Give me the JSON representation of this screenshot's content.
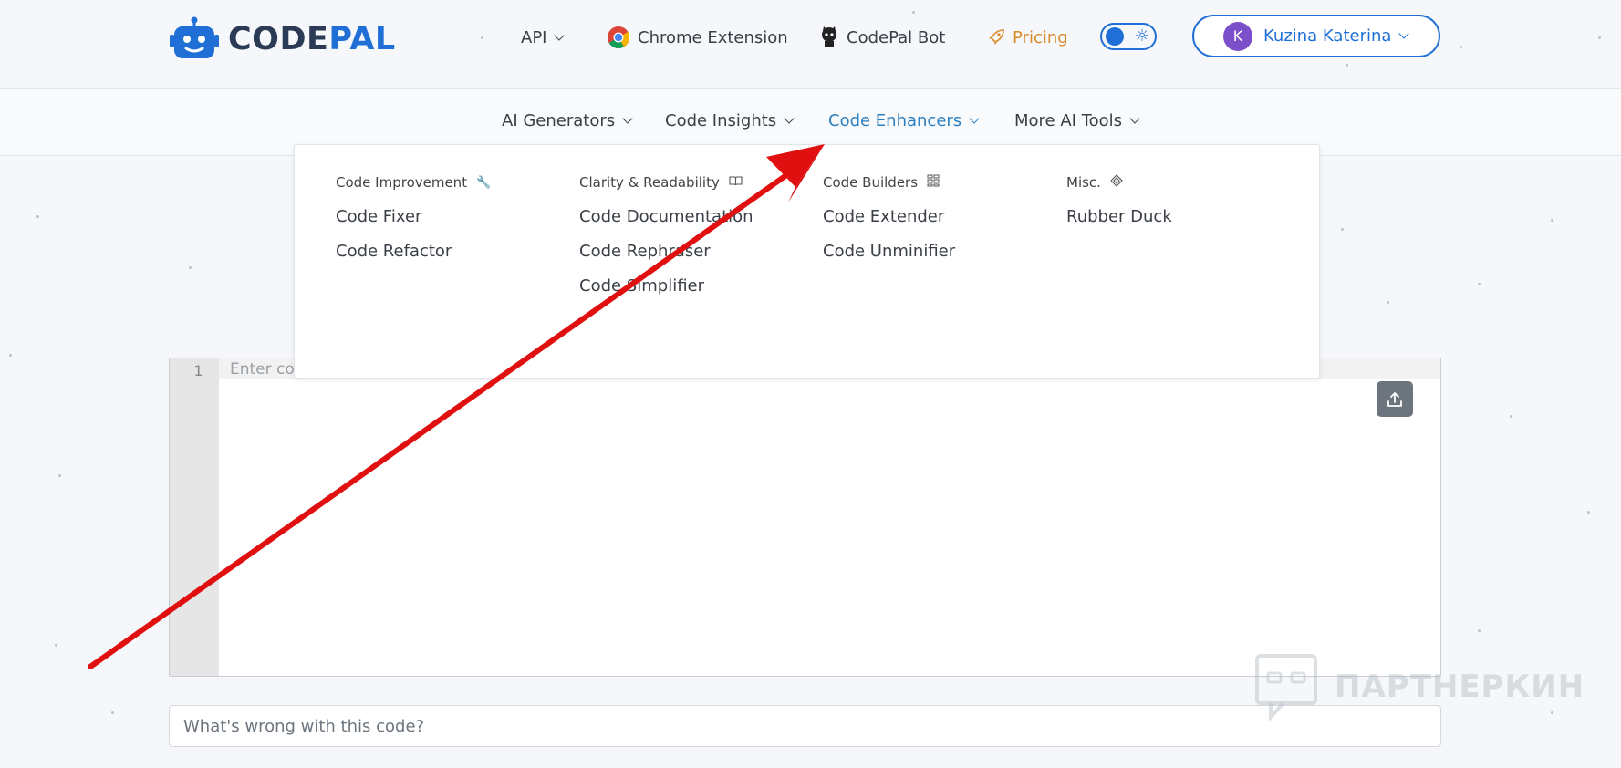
{
  "brand": {
    "logo_part1": "CODE",
    "logo_part2": "PAL"
  },
  "topnav": {
    "api": "API",
    "chrome": "Chrome Extension",
    "bot": "CodePal Bot",
    "pricing": "Pricing"
  },
  "user": {
    "initial": "K",
    "name": "Kuzina Katerina"
  },
  "subnav": {
    "items": [
      "AI Generators",
      "Code Insights",
      "Code Enhancers",
      "More AI Tools"
    ],
    "active": "Code Enhancers"
  },
  "dropdown": {
    "columns": [
      {
        "heading": "Code Improvement",
        "icon": "wrench-icon",
        "links": [
          "Code Fixer",
          "Code Refactor"
        ]
      },
      {
        "heading": "Clarity & Readability",
        "icon": "book-icon",
        "links": [
          "Code Documentation",
          "Code Rephraser",
          "Code Simplifier"
        ]
      },
      {
        "heading": "Code Builders",
        "icon": "blocks-icon",
        "links": [
          "Code Extender",
          "Code Unminifier"
        ]
      },
      {
        "heading": "Misc.",
        "icon": "diamond-icon",
        "links": [
          "Rubber Duck"
        ]
      }
    ]
  },
  "editor": {
    "line_number": "1",
    "placeholder": "Enter co"
  },
  "question_input": {
    "placeholder": "What's wrong with this code?"
  },
  "watermark": "ПАРТНЕРКИН",
  "colors": {
    "accent": "#1f6fd6",
    "active_nav": "#2a7fc0",
    "pricing": "#d98a2b",
    "annotation_arrow": "#e01010"
  }
}
